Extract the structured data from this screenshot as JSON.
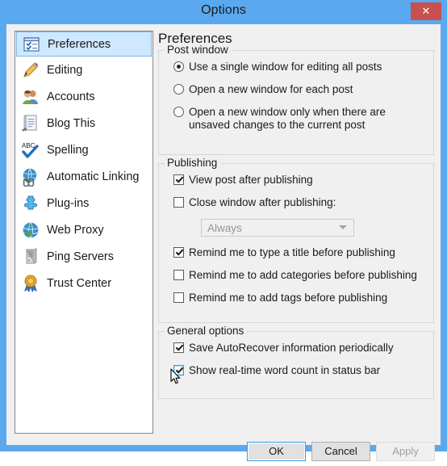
{
  "window": {
    "title": "Options",
    "close_label": "✕",
    "titlebar_color": "#5aa8f0",
    "close_color": "#c75050"
  },
  "sidebar": {
    "items": [
      {
        "label": "Preferences",
        "icon": "preferences-icon",
        "selected": true
      },
      {
        "label": "Editing",
        "icon": "pencil-icon",
        "selected": false
      },
      {
        "label": "Accounts",
        "icon": "accounts-people-icon",
        "selected": false
      },
      {
        "label": "Blog This",
        "icon": "blog-note-icon",
        "selected": false
      },
      {
        "label": "Spelling",
        "icon": "abc-checkmark-icon",
        "selected": false
      },
      {
        "label": "Automatic Linking",
        "icon": "globe-link-icon",
        "selected": false
      },
      {
        "label": "Plug-ins",
        "icon": "puzzle-piece-icon",
        "selected": false
      },
      {
        "label": "Web Proxy",
        "icon": "globe-icon",
        "selected": false
      },
      {
        "label": "Ping Servers",
        "icon": "server-tower-icon",
        "selected": false
      },
      {
        "label": "Trust Center",
        "icon": "trust-rosette-icon",
        "selected": false
      }
    ]
  },
  "main": {
    "page_title": "Preferences",
    "groups": [
      {
        "legend": "Post window",
        "type": "radio",
        "options": [
          {
            "label": "Use a single window for editing all posts",
            "checked": true
          },
          {
            "label": "Open a new window for each post",
            "checked": false
          },
          {
            "label": "Open a new window only when there are unsaved changes to the current post",
            "checked": false
          }
        ]
      },
      {
        "legend": "Publishing",
        "type": "checkbox",
        "options": [
          {
            "label": "View post after publishing",
            "checked": true
          },
          {
            "label": "Close window after publishing:",
            "checked": false
          },
          {
            "label": "Remind me to type a title before publishing",
            "checked": true
          },
          {
            "label": "Remind me to add categories before publishing",
            "checked": false
          },
          {
            "label": "Remind me to add tags before publishing",
            "checked": false
          }
        ],
        "combo": {
          "value": "Always",
          "enabled": false,
          "options": [
            "Always"
          ]
        }
      },
      {
        "legend": "General options",
        "type": "checkbox",
        "options": [
          {
            "label": "Save AutoRecover information periodically",
            "checked": true,
            "hover": false
          },
          {
            "label": "Show real-time word count in status bar",
            "checked": true,
            "hover": true
          }
        ]
      }
    ]
  },
  "buttons": {
    "ok": "OK",
    "cancel": "Cancel",
    "apply": "Apply"
  }
}
